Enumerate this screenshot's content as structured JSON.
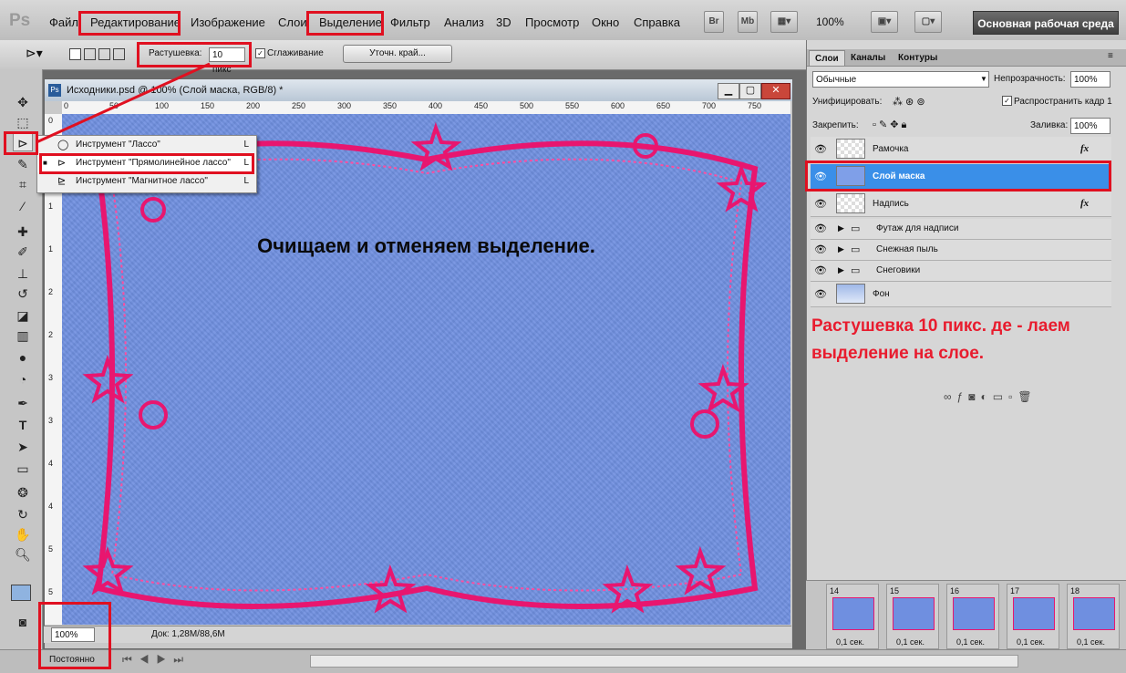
{
  "app": {
    "logo": "Ps"
  },
  "menu": [
    "Файл",
    "Редактирование",
    "Изображение",
    "Слои",
    "Выделение",
    "Фильтр",
    "Анализ",
    "3D",
    "Просмотр",
    "Окно",
    "Справка"
  ],
  "menubar_extras": {
    "br": "Br",
    "mb": "Mb",
    "zoom": "100%",
    "workspace": "Основная рабочая среда"
  },
  "options": {
    "feather_label": "Растушевка:",
    "feather_value": "10 пикс",
    "antialias_label": "Сглаживание",
    "refine_edge": "Уточн. край..."
  },
  "document": {
    "title": "Исходники.psd @ 100% (Слой маска, RGB/8) *",
    "canvas_text": "Очищаем и отменяем выделение.",
    "ruler_top": [
      "0",
      "50",
      "100",
      "150",
      "200",
      "250",
      "300",
      "350",
      "400",
      "450",
      "500",
      "550",
      "600",
      "650",
      "700",
      "750"
    ],
    "ruler_left": [
      "0",
      "5",
      "1",
      "1",
      "2",
      "2",
      "3",
      "3",
      "4",
      "4",
      "5",
      "5"
    ]
  },
  "lasso_menu": {
    "items": [
      {
        "label": "Инструмент \"Лассо\"",
        "key": "L"
      },
      {
        "label": "Инструмент \"Прямолинейное лассо\"",
        "key": "L"
      },
      {
        "label": "Инструмент \"Магнитное лассо\"",
        "key": "L"
      }
    ]
  },
  "panel": {
    "tabs": [
      "Слои",
      "Каналы",
      "Контуры"
    ],
    "blend_mode": "Обычные",
    "opacity_label": "Непрозрачность:",
    "opacity_value": "100%",
    "unify_label": "Унифицировать:",
    "propagate_label": "Распространить кадр 1",
    "lock_label": "Закрепить:",
    "fill_label": "Заливка:",
    "fill_value": "100%",
    "layers": [
      {
        "name": "Рамочка",
        "fx": "fx"
      },
      {
        "name": "Слой маска",
        "fx": ""
      },
      {
        "name": "Надпись",
        "fx": "fx"
      },
      {
        "name": "Футаж для надписи",
        "fx": ""
      },
      {
        "name": "Снежная пыль",
        "fx": ""
      },
      {
        "name": "Снеговики",
        "fx": ""
      },
      {
        "name": "Фон",
        "fx": ""
      }
    ],
    "annotation": "Растушевка 10 пикс. де - лаем выделение на слое."
  },
  "animation": {
    "frames": [
      {
        "num": "14",
        "time": "0,1 сек."
      },
      {
        "num": "15",
        "time": "0,1 сек."
      },
      {
        "num": "16",
        "time": "0,1 сек."
      },
      {
        "num": "17",
        "time": "0,1 сек."
      },
      {
        "num": "18",
        "time": "0,1 сек."
      }
    ],
    "left_time": "0,1 сек."
  },
  "status": {
    "zoom": "100%",
    "doc": "Док: 1,28M/88,6M",
    "loop": "Постоянно"
  },
  "colors": {
    "accent_red": "#e01020",
    "selected_layer": "#3a8fe8",
    "canvas_blue": "#6f8fe0",
    "frame_pink": "#e8166f"
  }
}
